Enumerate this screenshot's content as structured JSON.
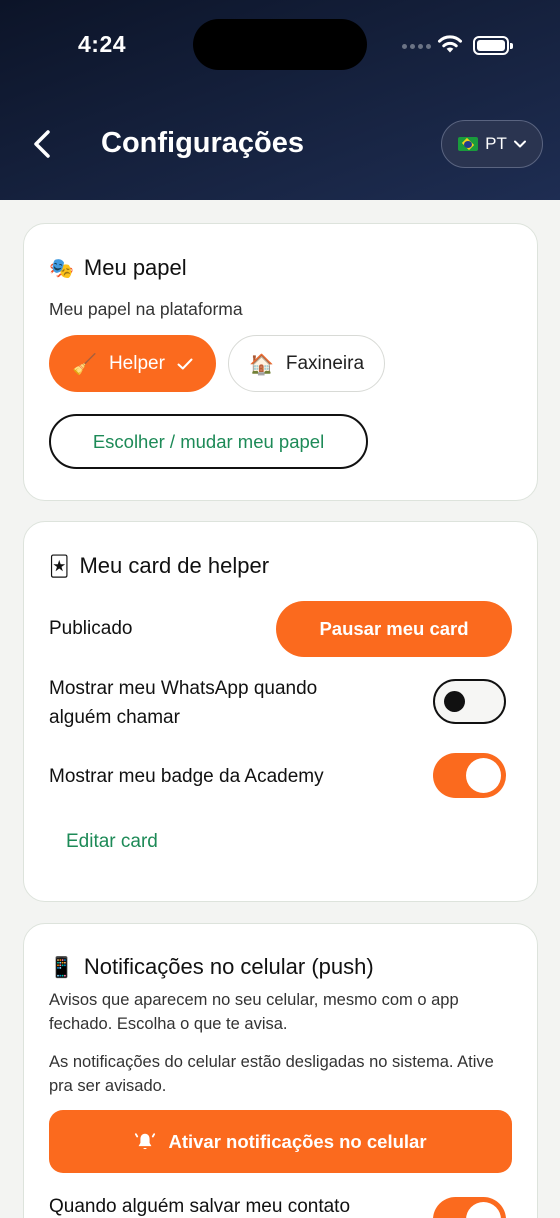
{
  "status_bar": {
    "time": "4:24"
  },
  "header": {
    "title": "Configurações",
    "language": "PT"
  },
  "role_card": {
    "emoji": "🎭",
    "title": "Meu papel",
    "subtitle": "Meu papel na plataforma",
    "options": [
      {
        "emoji": "🧹",
        "label": "Helper",
        "selected": true
      },
      {
        "emoji": "🏠",
        "label": "Faxineira",
        "selected": false
      }
    ],
    "change_button": "Escolher / mudar meu papel"
  },
  "helper_card": {
    "emoji": "🃏",
    "title": "Meu card de helper",
    "status": "Publicado",
    "pause_button": "Pausar meu card",
    "settings": [
      {
        "label": "Mostrar meu WhatsApp quando alguém chamar",
        "on": false
      },
      {
        "label": "Mostrar meu badge da Academy",
        "on": true
      }
    ],
    "edit_link": "Editar card"
  },
  "push_card": {
    "emoji": "📱",
    "title": "Notificações no celular (push)",
    "description": "Avisos que aparecem no seu celular, mesmo com o app fechado. Escolha o que te avisa.",
    "warning": "As notificações do celular estão desligadas no sistema. Ative pra ser avisado.",
    "enable_button": "Ativar notificações no celular",
    "settings": [
      {
        "label": "Quando alguém salvar meu contato",
        "on": true
      }
    ]
  },
  "colors": {
    "accent": "#fb6a1e",
    "link": "#1d8a57",
    "header": "#16223f"
  }
}
